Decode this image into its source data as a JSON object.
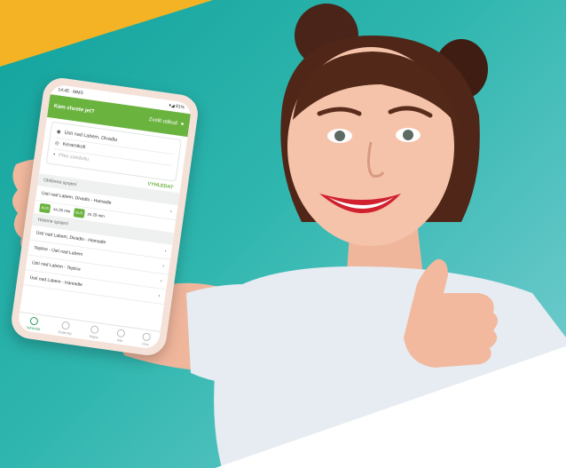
{
  "phone_app": {
    "status_time": "14:45 · MMS",
    "status_icons": "▾◢ 81%",
    "header_title": "Kam chcete jet?",
    "header_link": "Zvolit odkud",
    "from": "Ústí nad Labem, Divadlo",
    "to": "Keramikoli",
    "via_placeholder": "Přes zastávku",
    "search_button": "VYHLEDAT",
    "favorites_section": "Oblíbená spojení",
    "favorite_route": "Ústí nad Labem, Divadlo - Hamadle",
    "chip_1": "BUS",
    "time_1": "za 26 min",
    "chip_2": "BUS",
    "time_2": "za 29 min",
    "recent_section": "Historie spojení",
    "recent_items": [
      "Ústí nad Labem, Divadlo - Hamadle",
      "Teplice - Ústí nad Labem",
      "Ústí nad Labem - Teplice",
      "Ústí nad Labem - Hamadle"
    ],
    "tabs": [
      "Vyhledat",
      "Jízdenky",
      "Mapa",
      "Info",
      "Více"
    ],
    "active_tab": "Vyhledat"
  },
  "colors": {
    "teal": "#1fa8a4",
    "yellow": "#f3b325",
    "app_green": "#6bb33f"
  }
}
